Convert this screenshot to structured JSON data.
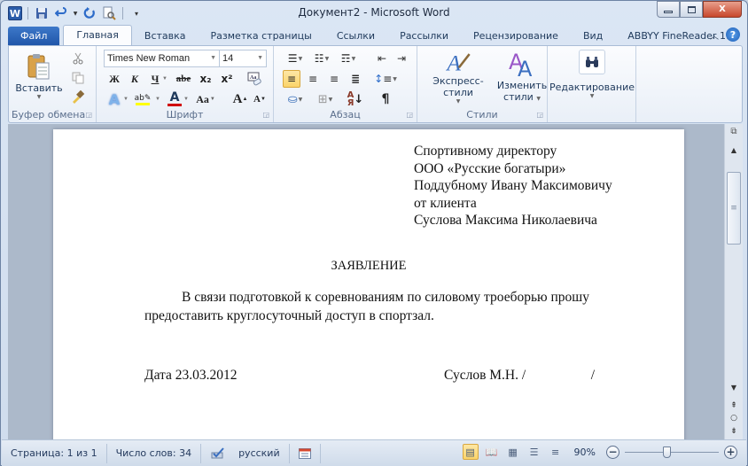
{
  "window": {
    "title": "Документ2 - Microsoft Word",
    "controls": {
      "minimize": "▭",
      "maximize": "□",
      "close": "X"
    }
  },
  "quick_access": {
    "icons": [
      "word-logo-icon",
      "save-icon",
      "undo-icon",
      "redo-icon",
      "print-preview-icon",
      "customize-qat-icon"
    ],
    "word_logo": "W"
  },
  "tabs": [
    {
      "label": "Файл",
      "type": "file"
    },
    {
      "label": "Главная",
      "active": true
    },
    {
      "label": "Вставка"
    },
    {
      "label": "Разметка страницы"
    },
    {
      "label": "Ссылки"
    },
    {
      "label": "Рассылки"
    },
    {
      "label": "Рецензирование"
    },
    {
      "label": "Вид"
    },
    {
      "label": "ABBYY FineReader 11"
    }
  ],
  "ribbon": {
    "clipboard": {
      "label": "Буфер обмена",
      "paste_label": "Вставить"
    },
    "font": {
      "label": "Шрифт",
      "font_name": "Times New Roman",
      "font_size": "14",
      "bold": "Ж",
      "italic": "К",
      "underline": "Ч",
      "strikethrough": "abe",
      "subscript": "x₂",
      "superscript": "x²",
      "change_case": "Aa",
      "grow": "A",
      "shrink": "A"
    },
    "paragraph": {
      "label": "Абзац",
      "pilcrow": "¶",
      "align_selected": "left"
    },
    "styles": {
      "label": "Стили",
      "quick_styles": "Экспресс-стили",
      "change_styles_1": "Изменить",
      "change_styles_2": "стили"
    },
    "editing": {
      "label": "Редактирование"
    }
  },
  "document": {
    "addressee": [
      "Спортивному директору",
      "ООО «Русские богатыри»",
      "Поддубному Ивану Максимовичу",
      "от клиента",
      "Суслова Максима Николаевича"
    ],
    "heading": "ЗАЯВЛЕНИЕ",
    "body_line1": "В связи подготовкой к соревнованиям по силовому троеборью прошу",
    "body_line2": "предоставить круглосуточный доступ в спортзал.",
    "date": "Дата 23.03.2012",
    "signature": "Суслов М.Н. /                   /"
  },
  "status_bar": {
    "page": "Страница: 1 из 1",
    "words": "Число слов: 34",
    "language": "русский",
    "zoom": "90%",
    "zoom_value_percent": 90
  },
  "colors": {
    "file_tab": "#2a62b8",
    "selected_button": "#fbd46a",
    "highlight_yellow": "#ffff00",
    "font_color_red": "#d00000",
    "close_button": "#c8472c"
  }
}
